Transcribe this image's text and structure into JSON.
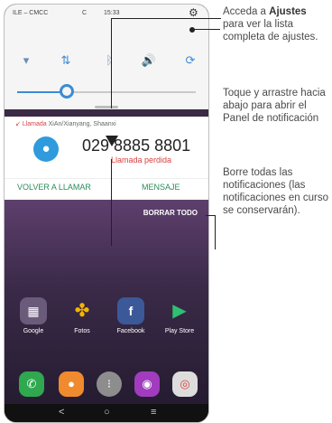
{
  "status_bar": {
    "carrier": "ILE – CMCC",
    "carrier2": "C",
    "time": "15:33"
  },
  "icons": {
    "gear": "gear-icon",
    "wifi_off": "wifi-off-icon",
    "data": "mobile-data-icon",
    "bluetooth": "bluetooth-icon",
    "sound": "sound-icon",
    "rotate": "auto-rotate-icon",
    "brightness": "brightness-icon",
    "avatar": "person-icon"
  },
  "brightness": {
    "level_fraction": 0.28
  },
  "notification": {
    "app_label": "Llamada",
    "meta": "XiAn/Xianyang, Shaanxi",
    "number": "029 8885 8801",
    "subtitle": "Llamada perdida",
    "action_callback": "VOLVER A LLAMAR",
    "action_message": "MENSAJE"
  },
  "home": {
    "clear_all": "BORRAR TODO",
    "apps": [
      {
        "name": "Google",
        "icon": "google-folder-icon",
        "color": "#6b5b7b"
      },
      {
        "name": "Fotos",
        "icon": "photos-icon",
        "color": "#00000000"
      },
      {
        "name": "Facebook",
        "icon": "facebook-icon",
        "color": "#3b5998"
      },
      {
        "name": "Play Store",
        "icon": "play-store-icon",
        "color": "#00000000"
      }
    ],
    "dock": [
      {
        "icon": "phone-icon",
        "color": "#2fa84f"
      },
      {
        "icon": "messages-icon",
        "color": "#f08a2e"
      },
      {
        "icon": "app-drawer-icon",
        "color": "#8d8d8d"
      },
      {
        "icon": "camera-icon",
        "color": "#a23cbf"
      },
      {
        "icon": "chrome-icon",
        "color": "#dddddd"
      }
    ],
    "nav": {
      "back": "<",
      "home": "○",
      "recents": "≡"
    }
  },
  "callouts": {
    "c1_pre": "Acceda a ",
    "c1_bold": "Ajustes",
    "c1_post": " para ver la lista completa de ajustes.",
    "c2": "Toque y arrastre hacia abajo para abrir el Panel de notificación",
    "c3": "Borre todas las notificaciones (las notificaciones en curso se conservarán)."
  }
}
